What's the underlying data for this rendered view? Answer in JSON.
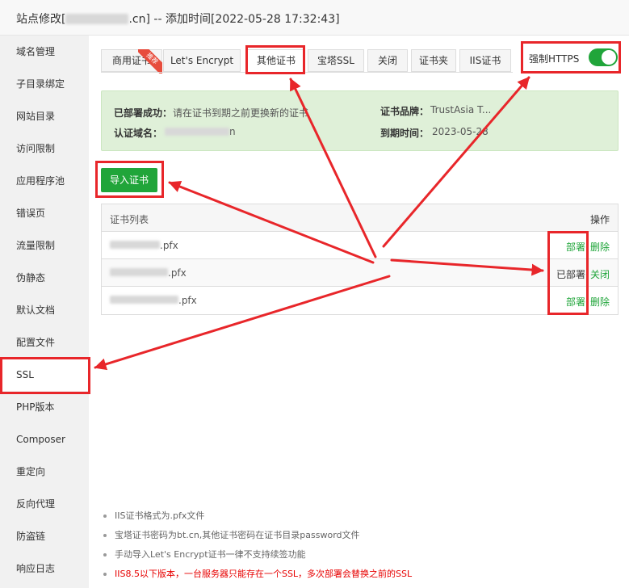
{
  "window": {
    "title_prefix": "站点修改[",
    "title_suffix": ".cn] -- 添加时间[2022-05-28 17:32:43]"
  },
  "sidebar": {
    "items": [
      "域名管理",
      "子目录绑定",
      "网站目录",
      "访问限制",
      "应用程序池",
      "错误页",
      "流量限制",
      "伪静态",
      "默认文档",
      "配置文件",
      "SSL",
      "PHP版本",
      "Composer",
      "重定向",
      "反向代理",
      "防盗链",
      "响应日志"
    ],
    "active": "SSL"
  },
  "tabs": {
    "items": [
      "商用证书",
      "Let's Encrypt",
      "其他证书",
      "宝塔SSL",
      "关闭",
      "证书夹",
      "IIS证书"
    ],
    "active": "其他证书",
    "ribbon": "推荐"
  },
  "force_https": {
    "label": "强制HTTPS",
    "enabled": true
  },
  "status": {
    "deploy_label": "已部署成功：",
    "deploy_value": "请在证书到期之前更换新的证书",
    "domain_label": "认证域名：",
    "domain_value_suffix": "n",
    "brand_label": "证书品牌：",
    "brand_value": "TrustAsia T...",
    "expire_label": "到期时间：",
    "expire_value": "2023-05-28"
  },
  "import_button": {
    "label": "导入证书"
  },
  "cert_table": {
    "header_name": "证书列表",
    "header_op": "操作",
    "rows": [
      {
        "name_suffix": ".pfx",
        "action_primary": "部署",
        "action_secondary": "删除",
        "deployed": false
      },
      {
        "name_suffix": ".pfx",
        "action_primary": "已部署",
        "action_secondary": "关闭",
        "deployed": true
      },
      {
        "name_suffix": ".pfx",
        "action_primary": "部署",
        "action_secondary": "删除",
        "deployed": false
      }
    ]
  },
  "notes": [
    "IIS证书格式为.pfx文件",
    "宝塔证书密码为bt.cn,其他证书密码在证书目录password文件",
    "手动导入Let's Encrypt证书一律不支持续签功能",
    "IIS8.5以下版本，一台服务器只能存在一个SSL，多次部署会替换之前的SSL"
  ],
  "colors": {
    "accent": "#20a53a",
    "annotation": "#e8262a",
    "warning": "#e70000",
    "info_bg": "#dff0d8"
  }
}
